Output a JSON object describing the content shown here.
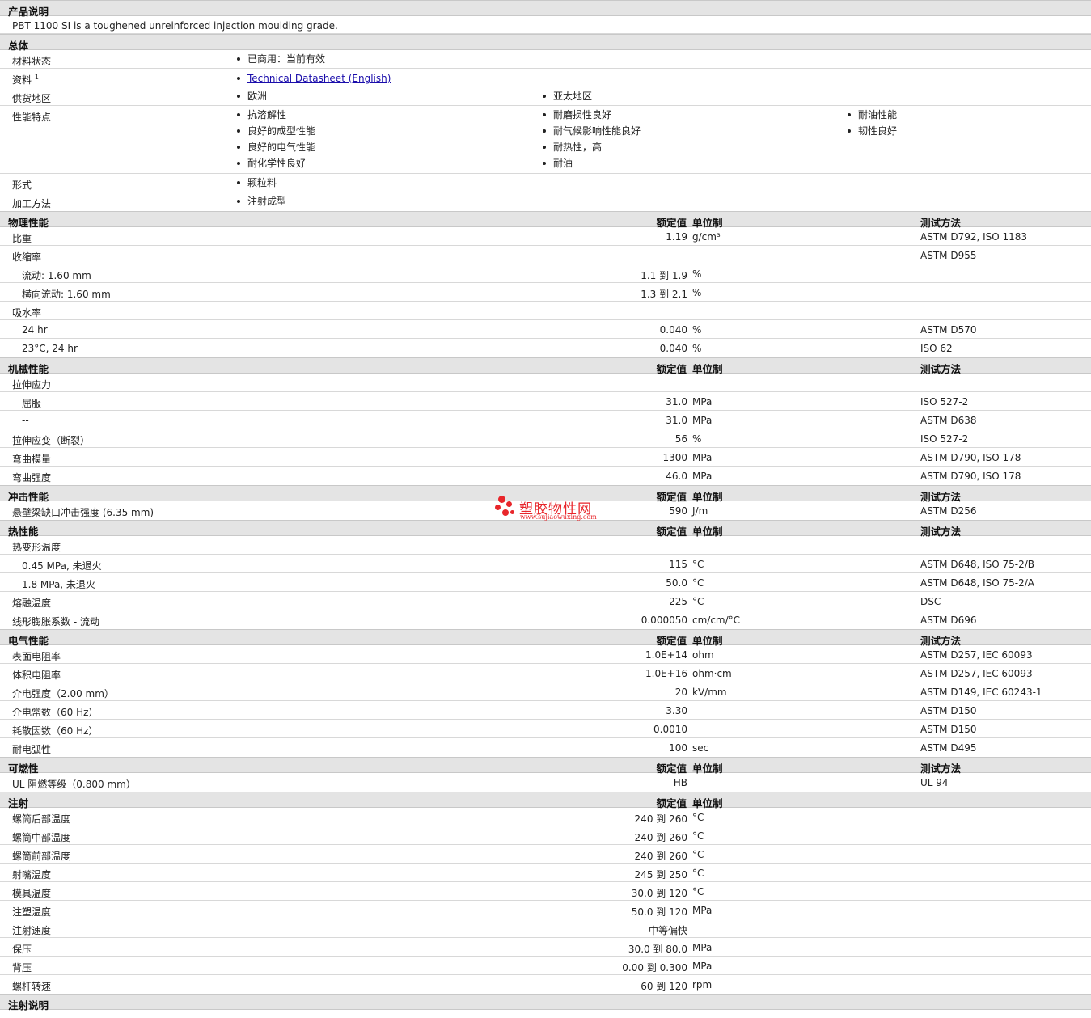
{
  "product_description": {
    "title": "产品说明",
    "text": "PBT 1100 SI is a toughened unreinforced injection moulding grade."
  },
  "general": {
    "title": "总体",
    "material_status": {
      "label": "材料状态",
      "items": [
        "已商用：当前有效"
      ]
    },
    "documents": {
      "label": "资料",
      "sup": "1",
      "link_text": "Technical Datasheet (English)"
    },
    "supply_region": {
      "label": "供货地区",
      "items": [
        "欧洲",
        "亚太地区"
      ]
    },
    "features": {
      "label": "性能特点",
      "col1": [
        "抗溶解性",
        "良好的成型性能",
        "良好的电气性能",
        "耐化学性良好"
      ],
      "col2": [
        "耐磨损性良好",
        "耐气候影响性能良好",
        "耐热性，高",
        "耐油"
      ],
      "col3": [
        "耐油性能",
        "韧性良好"
      ]
    },
    "form": {
      "label": "形式",
      "items": [
        "颗粒料"
      ]
    },
    "processing": {
      "label": "加工方法",
      "items": [
        "注射成型"
      ]
    }
  },
  "headers": {
    "nominal": "额定值",
    "unit": "单位制",
    "test": "测试方法"
  },
  "sections": [
    {
      "title": "物理性能",
      "show_test": true,
      "rows": [
        {
          "label": "比重",
          "value": "1.19",
          "unit": "g/cm³",
          "test": "ASTM D792, ISO 1183"
        },
        {
          "label": "收缩率",
          "value": "",
          "unit": "",
          "test": "ASTM D955"
        },
        {
          "label": "流动: 1.60 mm",
          "indent": true,
          "value": "1.1 到  1.9",
          "unit": "%",
          "test": ""
        },
        {
          "label": "横向流动: 1.60 mm",
          "indent": true,
          "value": "1.3 到  2.1",
          "unit": "%",
          "test": ""
        },
        {
          "label": "吸水率",
          "value": "",
          "unit": "",
          "test": ""
        },
        {
          "label": "24 hr",
          "indent": true,
          "value": "0.040",
          "unit": "%",
          "test": "ASTM D570"
        },
        {
          "label": "23°C, 24 hr",
          "indent": true,
          "value": "0.040",
          "unit": "%",
          "test": "ISO 62"
        }
      ]
    },
    {
      "title": "机械性能",
      "show_test": true,
      "rows": [
        {
          "label": "拉伸应力",
          "value": "",
          "unit": "",
          "test": ""
        },
        {
          "label": "屈服",
          "indent": true,
          "value": "31.0",
          "unit": "MPa",
          "test": "ISO 527-2"
        },
        {
          "label": "--",
          "indent": true,
          "value": "31.0",
          "unit": "MPa",
          "test": "ASTM D638"
        },
        {
          "label": "拉伸应变（断裂）",
          "value": "56",
          "unit": "%",
          "test": "ISO 527-2"
        },
        {
          "label": "弯曲模量",
          "value": "1300",
          "unit": "MPa",
          "test": "ASTM D790, ISO 178"
        },
        {
          "label": "弯曲强度",
          "value": "46.0",
          "unit": "MPa",
          "test": "ASTM D790, ISO 178"
        }
      ]
    },
    {
      "title": "冲击性能",
      "show_test": true,
      "rows": [
        {
          "label": "悬壁梁缺口冲击强度 (6.35 mm)",
          "value": "590",
          "unit": "J/m",
          "test": "ASTM D256"
        }
      ]
    },
    {
      "title": "热性能",
      "show_test": true,
      "rows": [
        {
          "label": "热变形温度",
          "value": "",
          "unit": "",
          "test": ""
        },
        {
          "label": "0.45 MPa, 未退火",
          "indent": true,
          "value": "115",
          "unit": "°C",
          "test": "ASTM D648, ISO 75-2/B"
        },
        {
          "label": "1.8 MPa, 未退火",
          "indent": true,
          "value": "50.0",
          "unit": "°C",
          "test": "ASTM D648, ISO 75-2/A"
        },
        {
          "label": "熔融温度",
          "value": "225",
          "unit": "°C",
          "test": "DSC"
        },
        {
          "label": "线形膨胀系数 - 流动",
          "value": "0.000050",
          "unit": "cm/cm/°C",
          "test": "ASTM D696"
        }
      ]
    },
    {
      "title": "电气性能",
      "show_test": true,
      "rows": [
        {
          "label": "表面电阻率",
          "value": "1.0E+14",
          "unit": "ohm",
          "test": "ASTM D257, IEC 60093"
        },
        {
          "label": "体积电阻率",
          "value": "1.0E+16",
          "unit": "ohm·cm",
          "test": "ASTM D257, IEC 60093"
        },
        {
          "label": "介电强度（2.00 mm）",
          "value": "20",
          "unit": "kV/mm",
          "test": "ASTM D149, IEC 60243-1"
        },
        {
          "label": "介电常数（60 Hz）",
          "value": "3.30",
          "unit": "",
          "test": "ASTM D150"
        },
        {
          "label": "耗散因数（60 Hz）",
          "value": "0.0010",
          "unit": "",
          "test": "ASTM D150"
        },
        {
          "label": "耐电弧性",
          "value": "100",
          "unit": "sec",
          "test": "ASTM D495"
        }
      ]
    },
    {
      "title": "可燃性",
      "show_test": true,
      "rows": [
        {
          "label": "UL 阻燃等级（0.800 mm）",
          "value": "HB",
          "unit": "",
          "test": "UL 94"
        }
      ]
    },
    {
      "title": "注射",
      "show_test": false,
      "rows": [
        {
          "label": "螺筒后部温度",
          "value": "240 到  260",
          "unit": "°C",
          "test": ""
        },
        {
          "label": "螺筒中部温度",
          "value": "240 到  260",
          "unit": "°C",
          "test": ""
        },
        {
          "label": "螺筒前部温度",
          "value": "240 到  260",
          "unit": "°C",
          "test": ""
        },
        {
          "label": "射嘴温度",
          "value": "245 到  250",
          "unit": "°C",
          "test": ""
        },
        {
          "label": "模具温度",
          "value": "30.0 到  120",
          "unit": "°C",
          "test": ""
        },
        {
          "label": "注塑温度",
          "value": "50.0 到  120",
          "unit": "MPa",
          "test": ""
        },
        {
          "label": "注射速度",
          "value": "中等偏快",
          "unit": "",
          "test": ""
        },
        {
          "label": "保压",
          "value": "30.0 到  80.0",
          "unit": "MPa",
          "test": ""
        },
        {
          "label": "背压",
          "value": "0.00 到  0.300",
          "unit": "MPa",
          "test": ""
        },
        {
          "label": "螺杆转速",
          "value": "60 到  120",
          "unit": "rpm",
          "test": ""
        }
      ]
    }
  ],
  "injection_notes": {
    "title": "注射说明"
  },
  "watermark": {
    "cn": "塑胶物性网",
    "url": "www.sujiaowuxing.com",
    "color": "#e8262b"
  }
}
